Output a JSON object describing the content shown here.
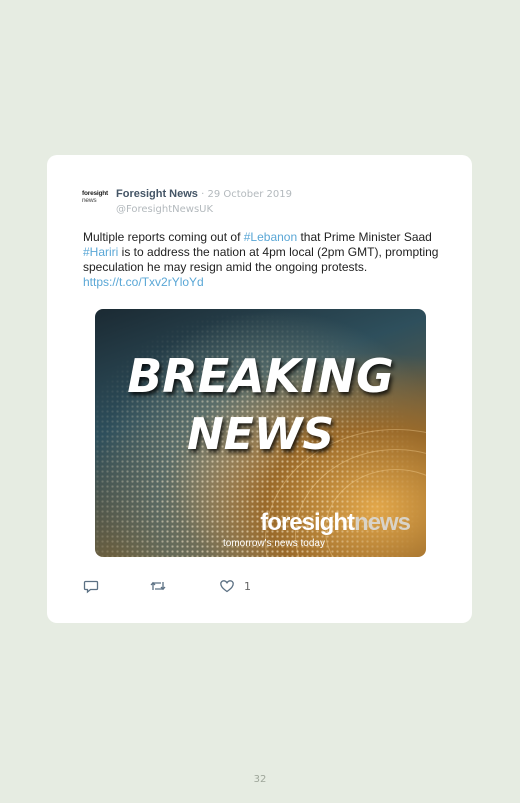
{
  "tweet": {
    "avatar_line1": "foresight",
    "avatar_line2": "news",
    "author_name": "Foresight News",
    "separator": " · ",
    "date": "29 October 2019",
    "handle": "@ForesightNewsUK",
    "text_1": "Multiple reports coming out of ",
    "hashtag_1": "#Lebanon",
    "text_2": " that Prime Minister Saad ",
    "hashtag_2": "#Hariri",
    "text_3": " is to address the nation at 4pm local (2pm GMT), prompting speculation he may resign amid the ongoing protests. ",
    "link": "https://t.co/Txv2rYloYd",
    "media": {
      "headline_1": "BREAKING",
      "headline_2": "NEWS",
      "brand_part1": "foresight",
      "brand_part2": "news",
      "tagline": "tomorrow's news today"
    },
    "actions": {
      "reply_icon": "reply-icon",
      "retweet_icon": "retweet-icon",
      "like_icon": "heart-icon",
      "like_count": "1"
    }
  },
  "page_number": "32",
  "colors": {
    "background": "#e6ece2",
    "card": "#ffffff",
    "link": "#5aa7d6",
    "name": "#445566",
    "muted": "#b3b9bd"
  }
}
